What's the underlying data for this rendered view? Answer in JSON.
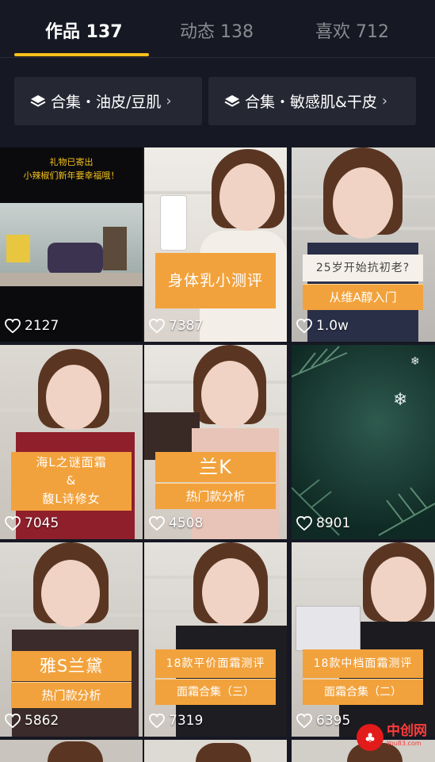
{
  "tabs": [
    {
      "label": "作品 137"
    },
    {
      "label": "动态 138"
    },
    {
      "label": "喜欢 712"
    }
  ],
  "collections": [
    {
      "label": "合集・油皮/豆肌"
    },
    {
      "label": "合集・敏感肌&干皮"
    }
  ],
  "videos": [
    {
      "likes": "2127",
      "card_top": "",
      "card_bottom": "",
      "banner_line1": "礼物已寄出",
      "banner_line2": "小辣椒们新年要幸福哦！"
    },
    {
      "likes": "7387",
      "card_top": "身体乳小测评",
      "card_bottom": ""
    },
    {
      "likes": "1.0w",
      "card_top": "25岁开始抗初老?",
      "card_bottom": "从维A醇入门"
    },
    {
      "likes": "7045",
      "card_top": "海L之谜面霜\n&\n馥L诗修女",
      "card_bottom": ""
    },
    {
      "likes": "4508",
      "card_top": "兰K",
      "card_bottom": "热门款分析"
    },
    {
      "likes": "8901",
      "card_top": "",
      "card_bottom": ""
    },
    {
      "likes": "5862",
      "card_top": "雅S兰黛",
      "card_bottom": "热门款分析"
    },
    {
      "likes": "7319",
      "card_top": "18款平价面霜测评",
      "card_bottom": "面霜合集（三）"
    },
    {
      "likes": "6395",
      "card_top": "18款中档面霜测评",
      "card_bottom": "面霜合集（二）"
    }
  ],
  "watermark": {
    "name": "中创网",
    "sub": "You83.com"
  },
  "colors": {
    "accent": "#f5c21b",
    "card": "#f2a23c",
    "background": "#161823"
  }
}
